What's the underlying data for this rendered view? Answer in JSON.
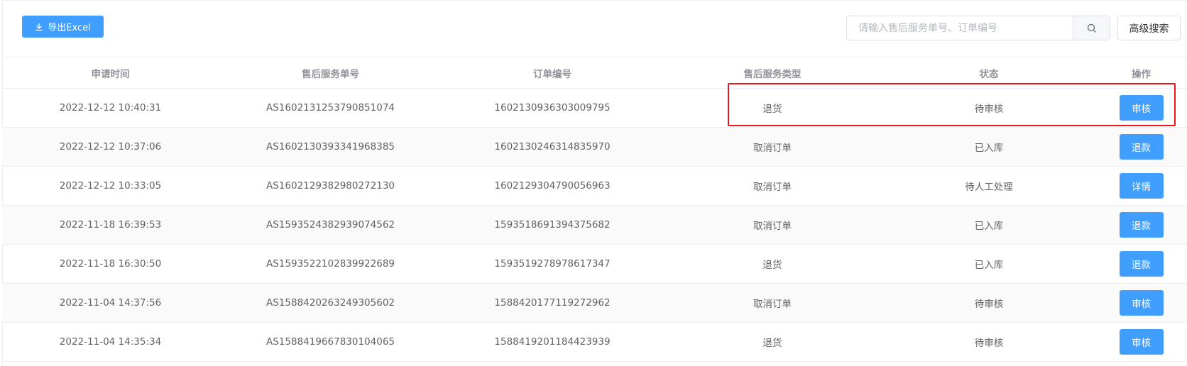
{
  "toolbar": {
    "export_label": "导出Excel",
    "search_placeholder": "请输入售后服务单号、订单编号",
    "search_value": "",
    "advanced_search_label": "高级搜索"
  },
  "table": {
    "headers": [
      "申请时间",
      "售后服务单号",
      "订单编号",
      "售后服务类型",
      "状态",
      "操作"
    ],
    "rows": [
      {
        "time": "2022-12-12 10:40:31",
        "service_no": "AS1602131253790851074",
        "order_no": "1602130936303009795",
        "type": "退货",
        "status": "待审核",
        "action": "审核"
      },
      {
        "time": "2022-12-12 10:37:06",
        "service_no": "AS1602130393341968385",
        "order_no": "1602130246314835970",
        "type": "取消订单",
        "status": "已入库",
        "action": "退款"
      },
      {
        "time": "2022-12-12 10:33:05",
        "service_no": "AS1602129382980272130",
        "order_no": "1602129304790056963",
        "type": "取消订单",
        "status": "待人工处理",
        "action": "详情"
      },
      {
        "time": "2022-11-18 16:39:53",
        "service_no": "AS1593524382939074562",
        "order_no": "1593518691394375682",
        "type": "取消订单",
        "status": "已入库",
        "action": "退款"
      },
      {
        "time": "2022-11-18 16:30:50",
        "service_no": "AS1593522102839922689",
        "order_no": "1593519278978617347",
        "type": "退货",
        "status": "已入库",
        "action": "退款"
      },
      {
        "time": "2022-11-04 14:37:56",
        "service_no": "AS1588420263249305602",
        "order_no": "1588420177119272962",
        "type": "取消订单",
        "status": "待审核",
        "action": "审核"
      },
      {
        "time": "2022-11-04 14:35:34",
        "service_no": "AS1588419667830104065",
        "order_no": "1588419201184423939",
        "type": "退货",
        "status": "待审核",
        "action": "审核"
      }
    ]
  },
  "colors": {
    "primary": "#409eff",
    "highlight": "#f0131b"
  },
  "icons": {
    "export": "download-icon",
    "search": "search-icon"
  }
}
